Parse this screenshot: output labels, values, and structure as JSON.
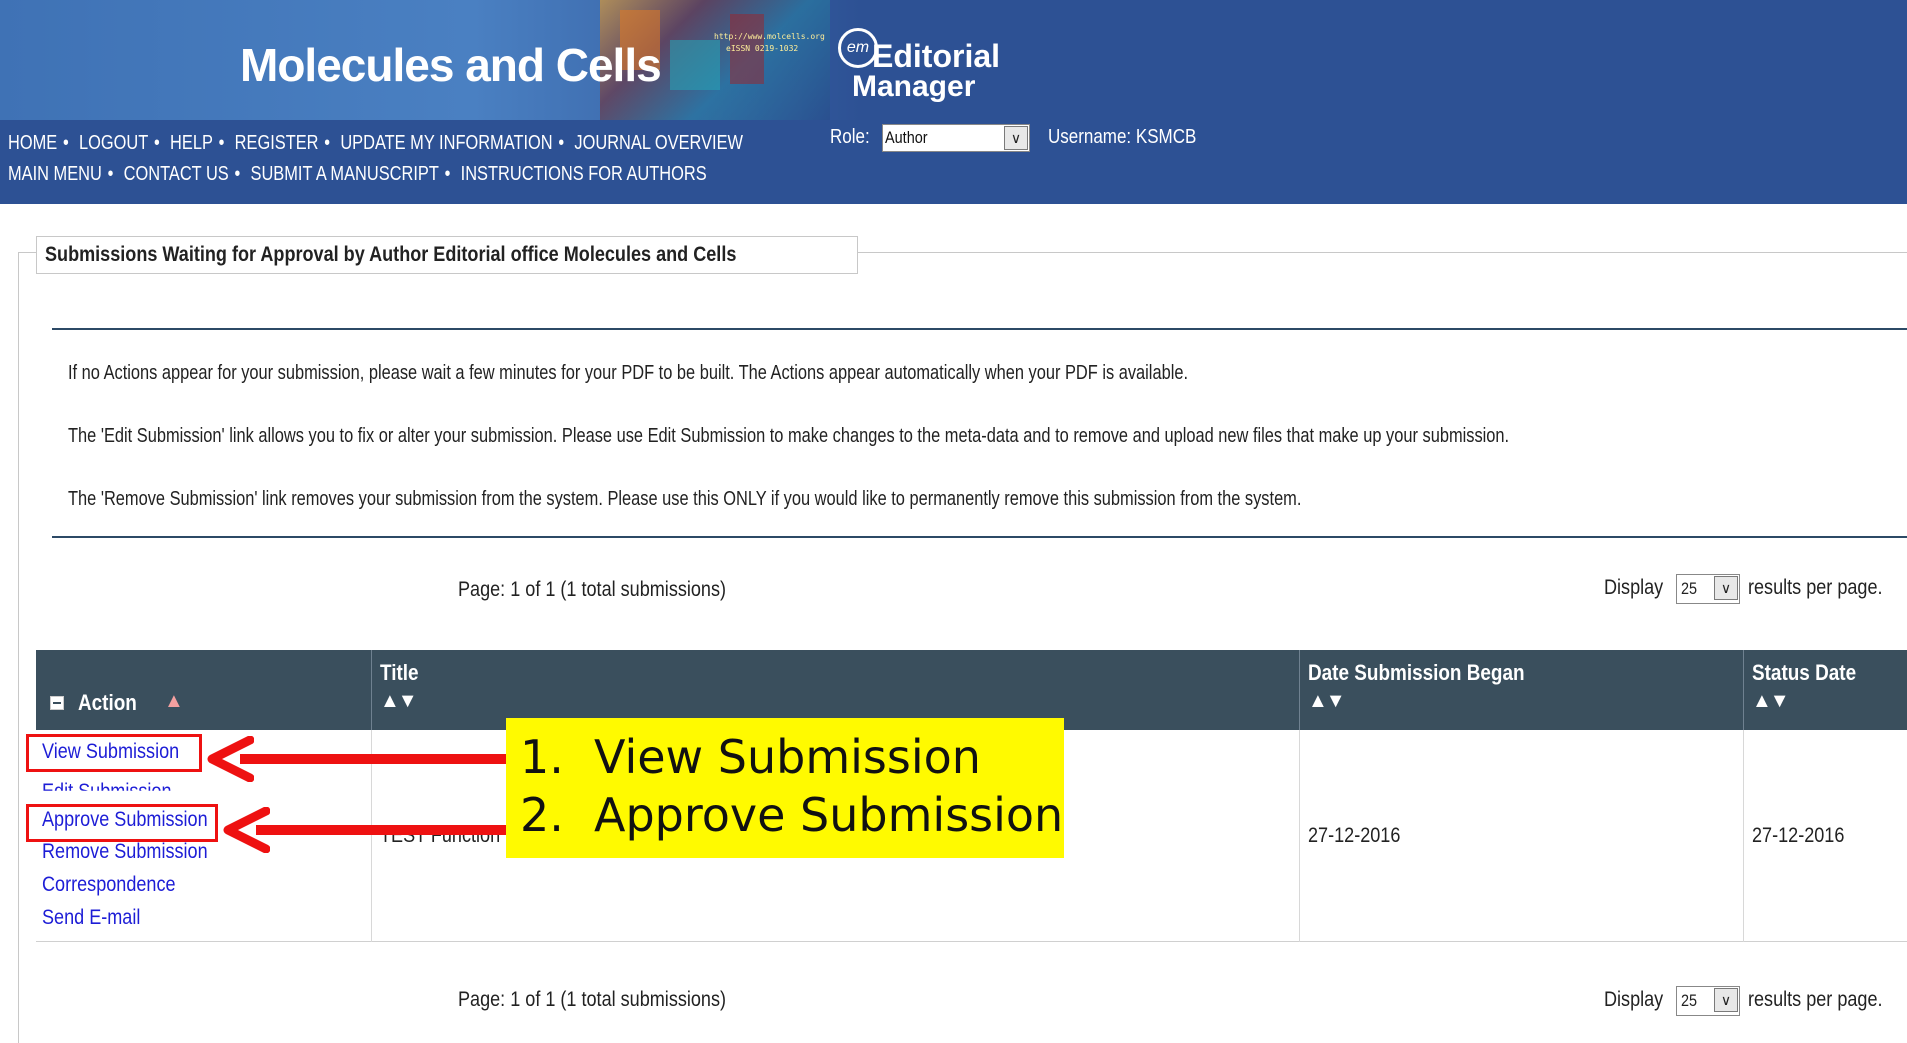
{
  "header": {
    "journal_title": "Molecules and Cells",
    "banner_url": "http://www.molcells.org",
    "banner_issn": "eISSN 0219-1032",
    "em_logo_circle": "em",
    "em_logo_line1": "Editorial",
    "em_logo_line2": "Manager",
    "nav_row1": [
      "HOME",
      "LOGOUT",
      "HELP",
      "REGISTER",
      "UPDATE MY INFORMATION",
      "JOURNAL OVERVIEW"
    ],
    "nav_row2": [
      "MAIN MENU",
      "CONTACT US",
      "SUBMIT A MANUSCRIPT",
      "INSTRUCTIONS FOR AUTHORS"
    ],
    "role_label": "Role:",
    "role_value": "Author",
    "username": "Username: KSMCB"
  },
  "section": {
    "title": "Submissions Waiting for Approval by Author Editorial office Molecules and Cells",
    "info": [
      "If no Actions appear for your submission, please wait a few minutes for your PDF to be built. The Actions appear automatically when your PDF is available.",
      "The 'Edit Submission' link allows you to fix or alter your submission. Please use Edit Submission to make changes to the meta-data and to remove and upload new files that make up your submission.",
      "The 'Remove Submission' link removes your submission from the system. Please use this ONLY if you would like to permanently remove this submission from the system."
    ]
  },
  "pager": {
    "text": "Page: 1 of 1 (1 total submissions)",
    "display_label": "Display",
    "display_value": "25",
    "display_after": "results per page."
  },
  "table": {
    "columns": {
      "action": "Action",
      "title": "Title",
      "date": "Date Submission Began",
      "status": "Status Date"
    },
    "sort_glyph": "▲▼",
    "row": {
      "actions": [
        "View Submission",
        "Edit Submission",
        "Approve Submission",
        "Remove Submission",
        "Correspondence",
        "Send E-mail"
      ],
      "title": "TEST Function",
      "date_began": "27-12-2016",
      "status_date": "27-12-2016"
    }
  },
  "annotation": {
    "item1_num": "1.",
    "item1_text": "View Submission",
    "item2_num": "2.",
    "item2_text": "Approve Submission",
    "highlight_color": "#fffa00",
    "marker_color": "#ee1111"
  },
  "colors": {
    "header_bg": "#2d5194",
    "table_head_bg": "#3a4f5d",
    "link": "#1d1dd6"
  }
}
